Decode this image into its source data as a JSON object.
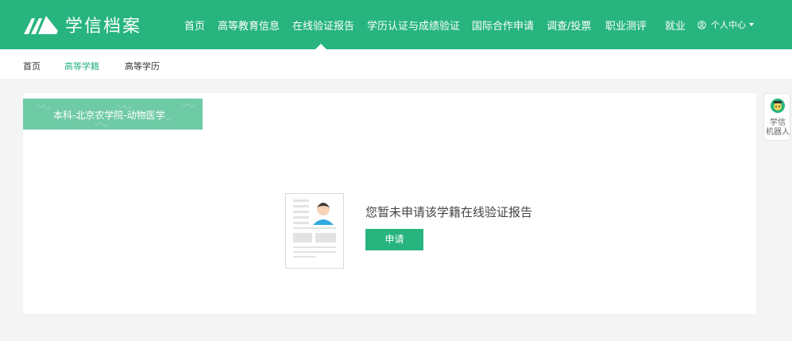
{
  "header": {
    "logo_text": "学信档案",
    "nav": [
      {
        "label": "首页"
      },
      {
        "label": "高等教育信息"
      },
      {
        "label": "在线验证报告"
      },
      {
        "label": "学历认证与成绩验证"
      },
      {
        "label": "国际合作申请"
      },
      {
        "label": "调查/投票"
      },
      {
        "label": "职业测评"
      },
      {
        "label": "就业"
      }
    ],
    "active_nav": "在线验证报告",
    "user_menu_label": "个人中心",
    "brand_color": "#27b47f"
  },
  "subnav": {
    "items": [
      {
        "label": "首页"
      },
      {
        "label": "高等学籍"
      },
      {
        "label": "高等学历"
      }
    ],
    "active": "高等学籍"
  },
  "card": {
    "tab_label": "本科-北京农学院-动物医学",
    "empty_message": "您暂未申请该学籍在线验证报告",
    "apply_button": "申请"
  },
  "robot": {
    "label_line1": "学信",
    "label_line2": "机器人"
  }
}
